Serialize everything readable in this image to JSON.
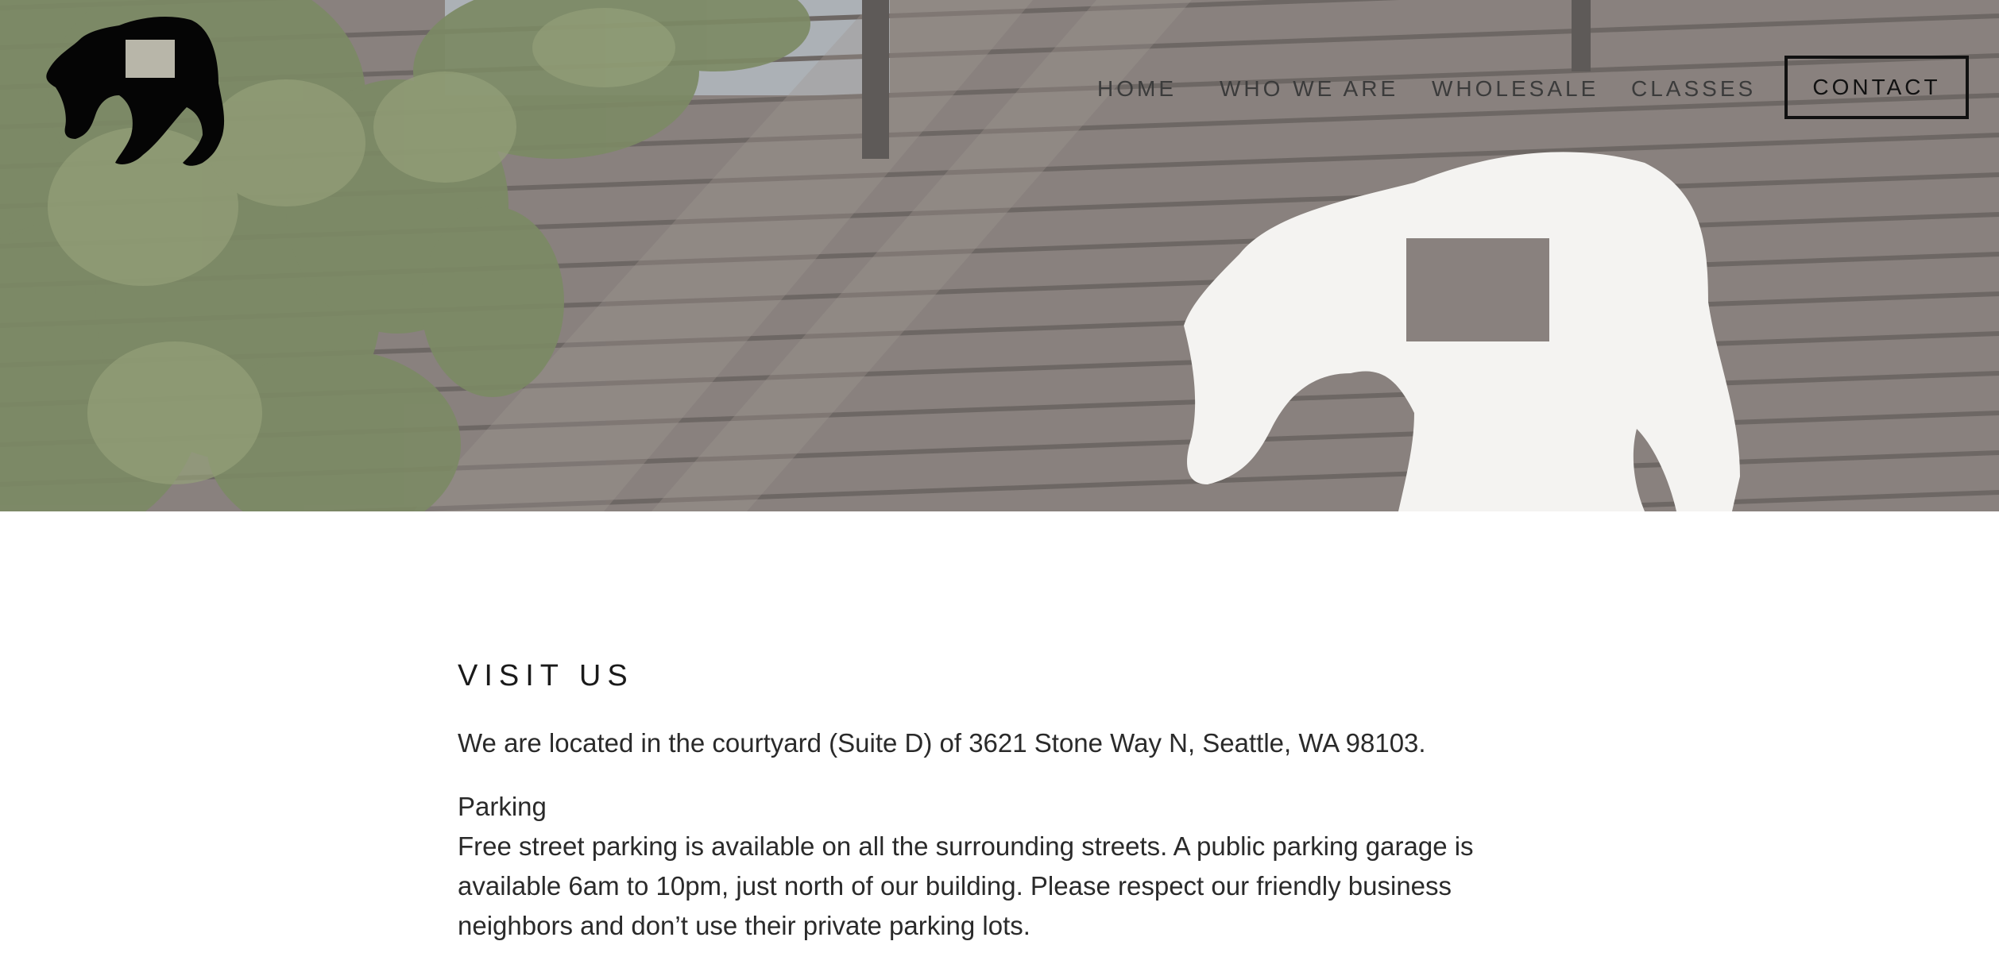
{
  "nav": {
    "items": [
      "HOME",
      "WHO WE ARE",
      "WHOLESALE",
      "CLASSES"
    ],
    "contact_label": "CONTACT"
  },
  "logo": {
    "icon": "horse-silhouette-logo"
  },
  "hero": {
    "image": "wooden-fence-with-painted-horse-and-tree"
  },
  "visit": {
    "title": "VISIT US",
    "location": "We are located in the courtyard (Suite D) of 3621 Stone Way N, Seattle, WA 98103.",
    "parking_heading": "Parking",
    "parking_text": "Free street parking is available on all the surrounding streets. A public parking garage is available 6am to 10pm, just north of our building. Please respect our friendly business neighbors and don’t use their private parking lots."
  },
  "colors": {
    "fence": "#6e6560",
    "text": "#2a2a2a",
    "button_border": "#111111"
  }
}
